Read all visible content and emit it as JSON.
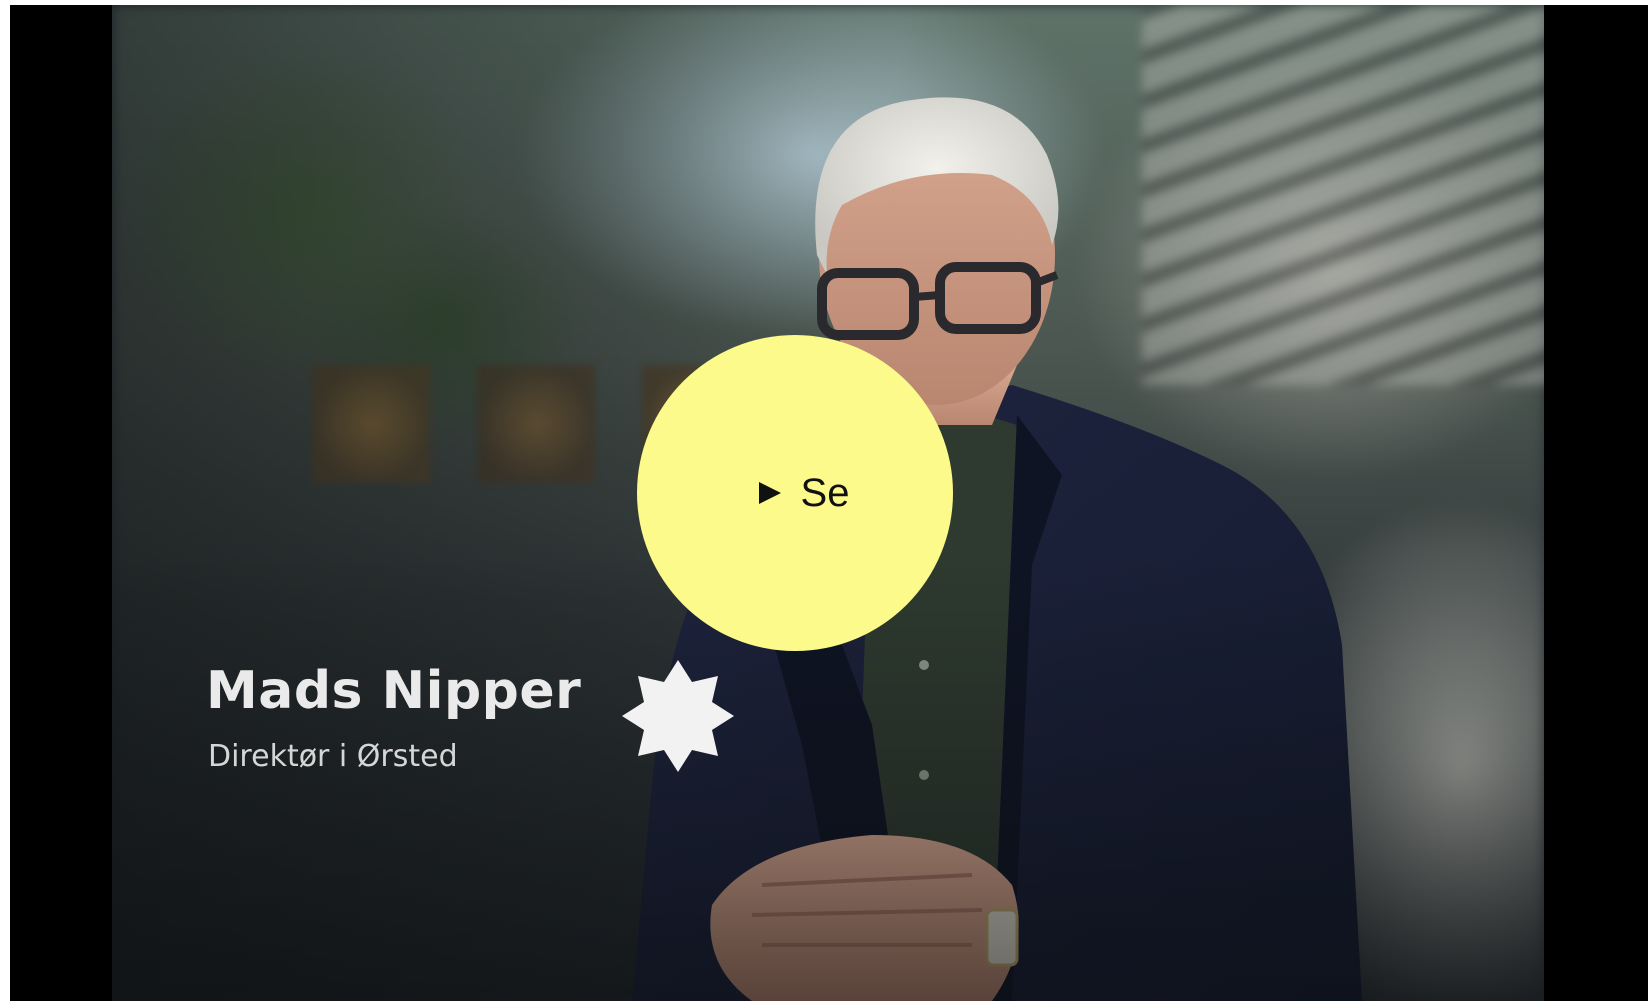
{
  "video": {
    "person_name": "Mads Nipper",
    "person_title": "Direktør i Ørsted",
    "play_button": {
      "label": "Se",
      "icon": "play-icon",
      "color": "#fdfa8c"
    },
    "logo_icon": "star-logo-icon"
  }
}
